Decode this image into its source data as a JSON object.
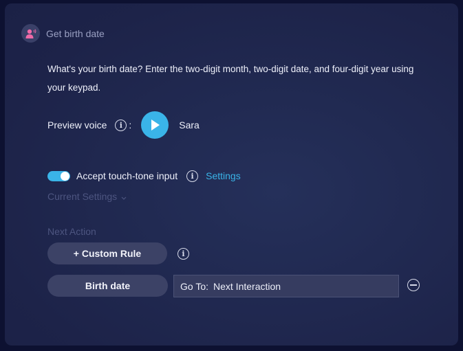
{
  "header": {
    "title": "Get birth date",
    "icon": "speaking-person-icon"
  },
  "prompt": {
    "text": "What's your birth date? Enter the two-digit month, two-digit date, and four-digit year using your keypad."
  },
  "preview_voice": {
    "label": "Preview voice",
    "colon": ":",
    "voice_name": "Sara"
  },
  "touch_tone": {
    "enabled": true,
    "label": "Accept touch-tone input",
    "settings_link": "Settings"
  },
  "current_settings": {
    "label": "Current Settings"
  },
  "next_action": {
    "label": "Next Action",
    "custom_rule_button": "+ Custom Rule",
    "rules": [
      {
        "name": "Birth date",
        "goto_label": "Go To:",
        "goto_value": "Next Interaction"
      }
    ]
  },
  "colors": {
    "accent": "#3ab4e8",
    "avatar_icon": "#f06aa8",
    "background": "#1d2349"
  }
}
